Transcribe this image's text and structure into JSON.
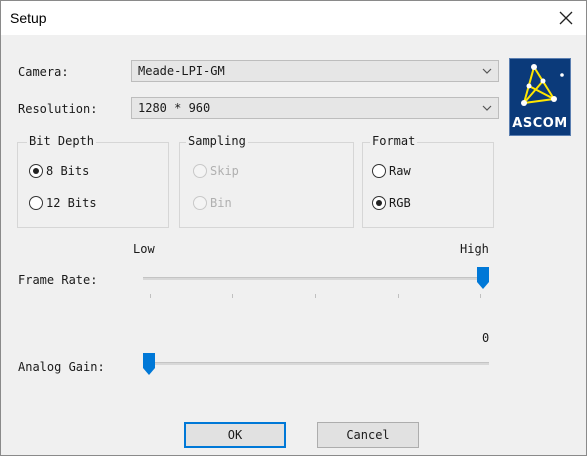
{
  "window": {
    "title": "Setup",
    "close_icon": "close-icon"
  },
  "camera": {
    "label": "Camera:",
    "value": "Meade-LPI-GM"
  },
  "resolution": {
    "label": "Resolution:",
    "value": "1280 * 960"
  },
  "logo": {
    "text": "ASCOM",
    "icon": "ascom-logo-icon"
  },
  "bit_depth": {
    "title": "Bit Depth",
    "options": [
      {
        "label": "8 Bits",
        "selected": true
      },
      {
        "label": "12 Bits",
        "selected": false
      }
    ]
  },
  "sampling": {
    "title": "Sampling",
    "options": [
      {
        "label": "Skip",
        "selected": false
      },
      {
        "label": "Bin",
        "selected": false
      }
    ],
    "enabled": false
  },
  "format": {
    "title": "Format",
    "options": [
      {
        "label": "Raw",
        "selected": false
      },
      {
        "label": "RGB",
        "selected": true
      }
    ]
  },
  "frame_rate": {
    "label": "Frame Rate:",
    "low_label": "Low",
    "high_label": "High",
    "value_fraction": 1.0
  },
  "analog_gain": {
    "label": "Analog Gain:",
    "value": "0",
    "value_fraction": 0.0
  },
  "buttons": {
    "ok": "OK",
    "cancel": "Cancel"
  },
  "colors": {
    "accent": "#0078d7",
    "logo_bg": "#0b3a7a"
  }
}
